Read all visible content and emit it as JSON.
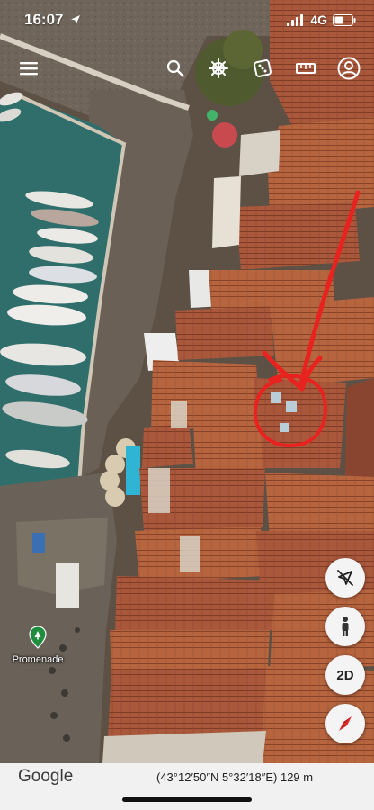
{
  "status_bar": {
    "time": "16:07",
    "network": "4G"
  },
  "toolbar": {
    "icons": [
      "menu-icon",
      "search-icon",
      "ship-wheel-icon",
      "dice-icon",
      "ruler-icon",
      "account-icon"
    ]
  },
  "map": {
    "view": "3D satellite",
    "poi": {
      "name": "Promenade",
      "icon": "location-pin-icon",
      "color": "#1e8e3e"
    },
    "annotation": {
      "type": "hand-drawn circle with arrow",
      "color": "#e8231f"
    }
  },
  "controls": {
    "compass_label": "2D",
    "buttons": [
      "no-tilt-icon",
      "pegman-icon",
      "2d-toggle",
      "compass-icon"
    ]
  },
  "bottom_bar": {
    "logo": "Google",
    "coordinates": "(43°12′50″N 5°32′18″E)",
    "altitude": "129 m"
  },
  "colors": {
    "annotation": "#e8231f",
    "water": "#2f6e6a",
    "roof": "#a8553a",
    "poi_green": "#1e8e3e"
  }
}
